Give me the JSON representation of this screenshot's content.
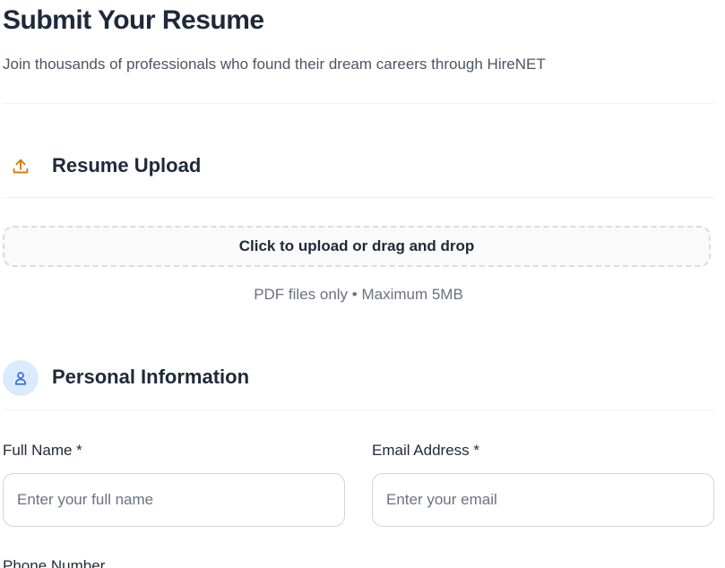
{
  "header": {
    "title": "Submit Your Resume",
    "subtitle": "Join thousands of professionals who found their dream careers through HireNET"
  },
  "resume_section": {
    "title": "Resume Upload",
    "icon": "upload-icon",
    "icon_color": "#d97706",
    "dropzone_label": "Click to upload or drag and drop",
    "hint": "PDF files only • Maximum 5MB"
  },
  "personal_section": {
    "title": "Personal Information",
    "icon": "user-icon",
    "icon_color": "#2563eb",
    "icon_bg": "#dbeafe",
    "full_name": {
      "label": "Full Name *",
      "placeholder": "Enter your full name",
      "value": ""
    },
    "email": {
      "label": "Email Address *",
      "placeholder": "Enter your email",
      "value": ""
    },
    "phone": {
      "label": "Phone Number"
    }
  }
}
